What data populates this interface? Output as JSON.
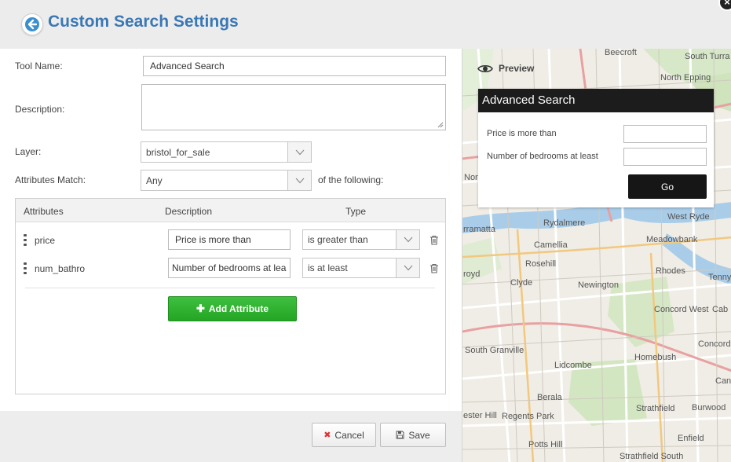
{
  "header": {
    "title": "Custom Search Settings",
    "back_icon": "back-arrow-icon",
    "close_icon": "close-icon"
  },
  "form": {
    "tool_name_label": "Tool Name:",
    "tool_name_value": "Advanced Search",
    "description_label": "Description:",
    "description_value": "",
    "layer_label": "Layer:",
    "layer_value": "bristol_for_sale",
    "match_label": "Attributes Match:",
    "match_value": "Any",
    "match_suffix": "of the following:"
  },
  "attributes": {
    "columns": [
      "Attributes",
      "Description",
      "Type"
    ],
    "rows": [
      {
        "name": "price",
        "description": "Price is more than",
        "type": "is greater than"
      },
      {
        "name": "num_bathro",
        "description": "Number of bedrooms at least",
        "type": "is at least"
      }
    ],
    "add_label": "Add Attribute"
  },
  "footer": {
    "cancel_label": "Cancel",
    "save_label": "Save"
  },
  "preview": {
    "label": "Preview",
    "title": "Advanced Search",
    "fields": [
      "Price is more than",
      "Number of bedrooms at least"
    ],
    "go_label": "Go"
  },
  "map": {
    "labels": [
      "Beecroft",
      "South Turra",
      "North Epping",
      "Nort",
      "rramatta",
      "Rydalmere",
      "West Ryde",
      "Meadowbank",
      "Camellia",
      "Rosehill",
      "Rhodes",
      "Tenny",
      "royd",
      "Clyde",
      "Newington",
      "Concord West",
      "Cab",
      "Concord",
      "South Granville",
      "Lidcombe",
      "Homebush",
      "Cana",
      "Berala",
      "ester Hill",
      "Regents Park",
      "Strathfield",
      "Burwood",
      "Enfield",
      "Potts Hill",
      "Strathfield South"
    ]
  },
  "colors": {
    "title": "#3a78b5",
    "add_button": "#2db22d",
    "preview_header": "#1c1c1c"
  }
}
